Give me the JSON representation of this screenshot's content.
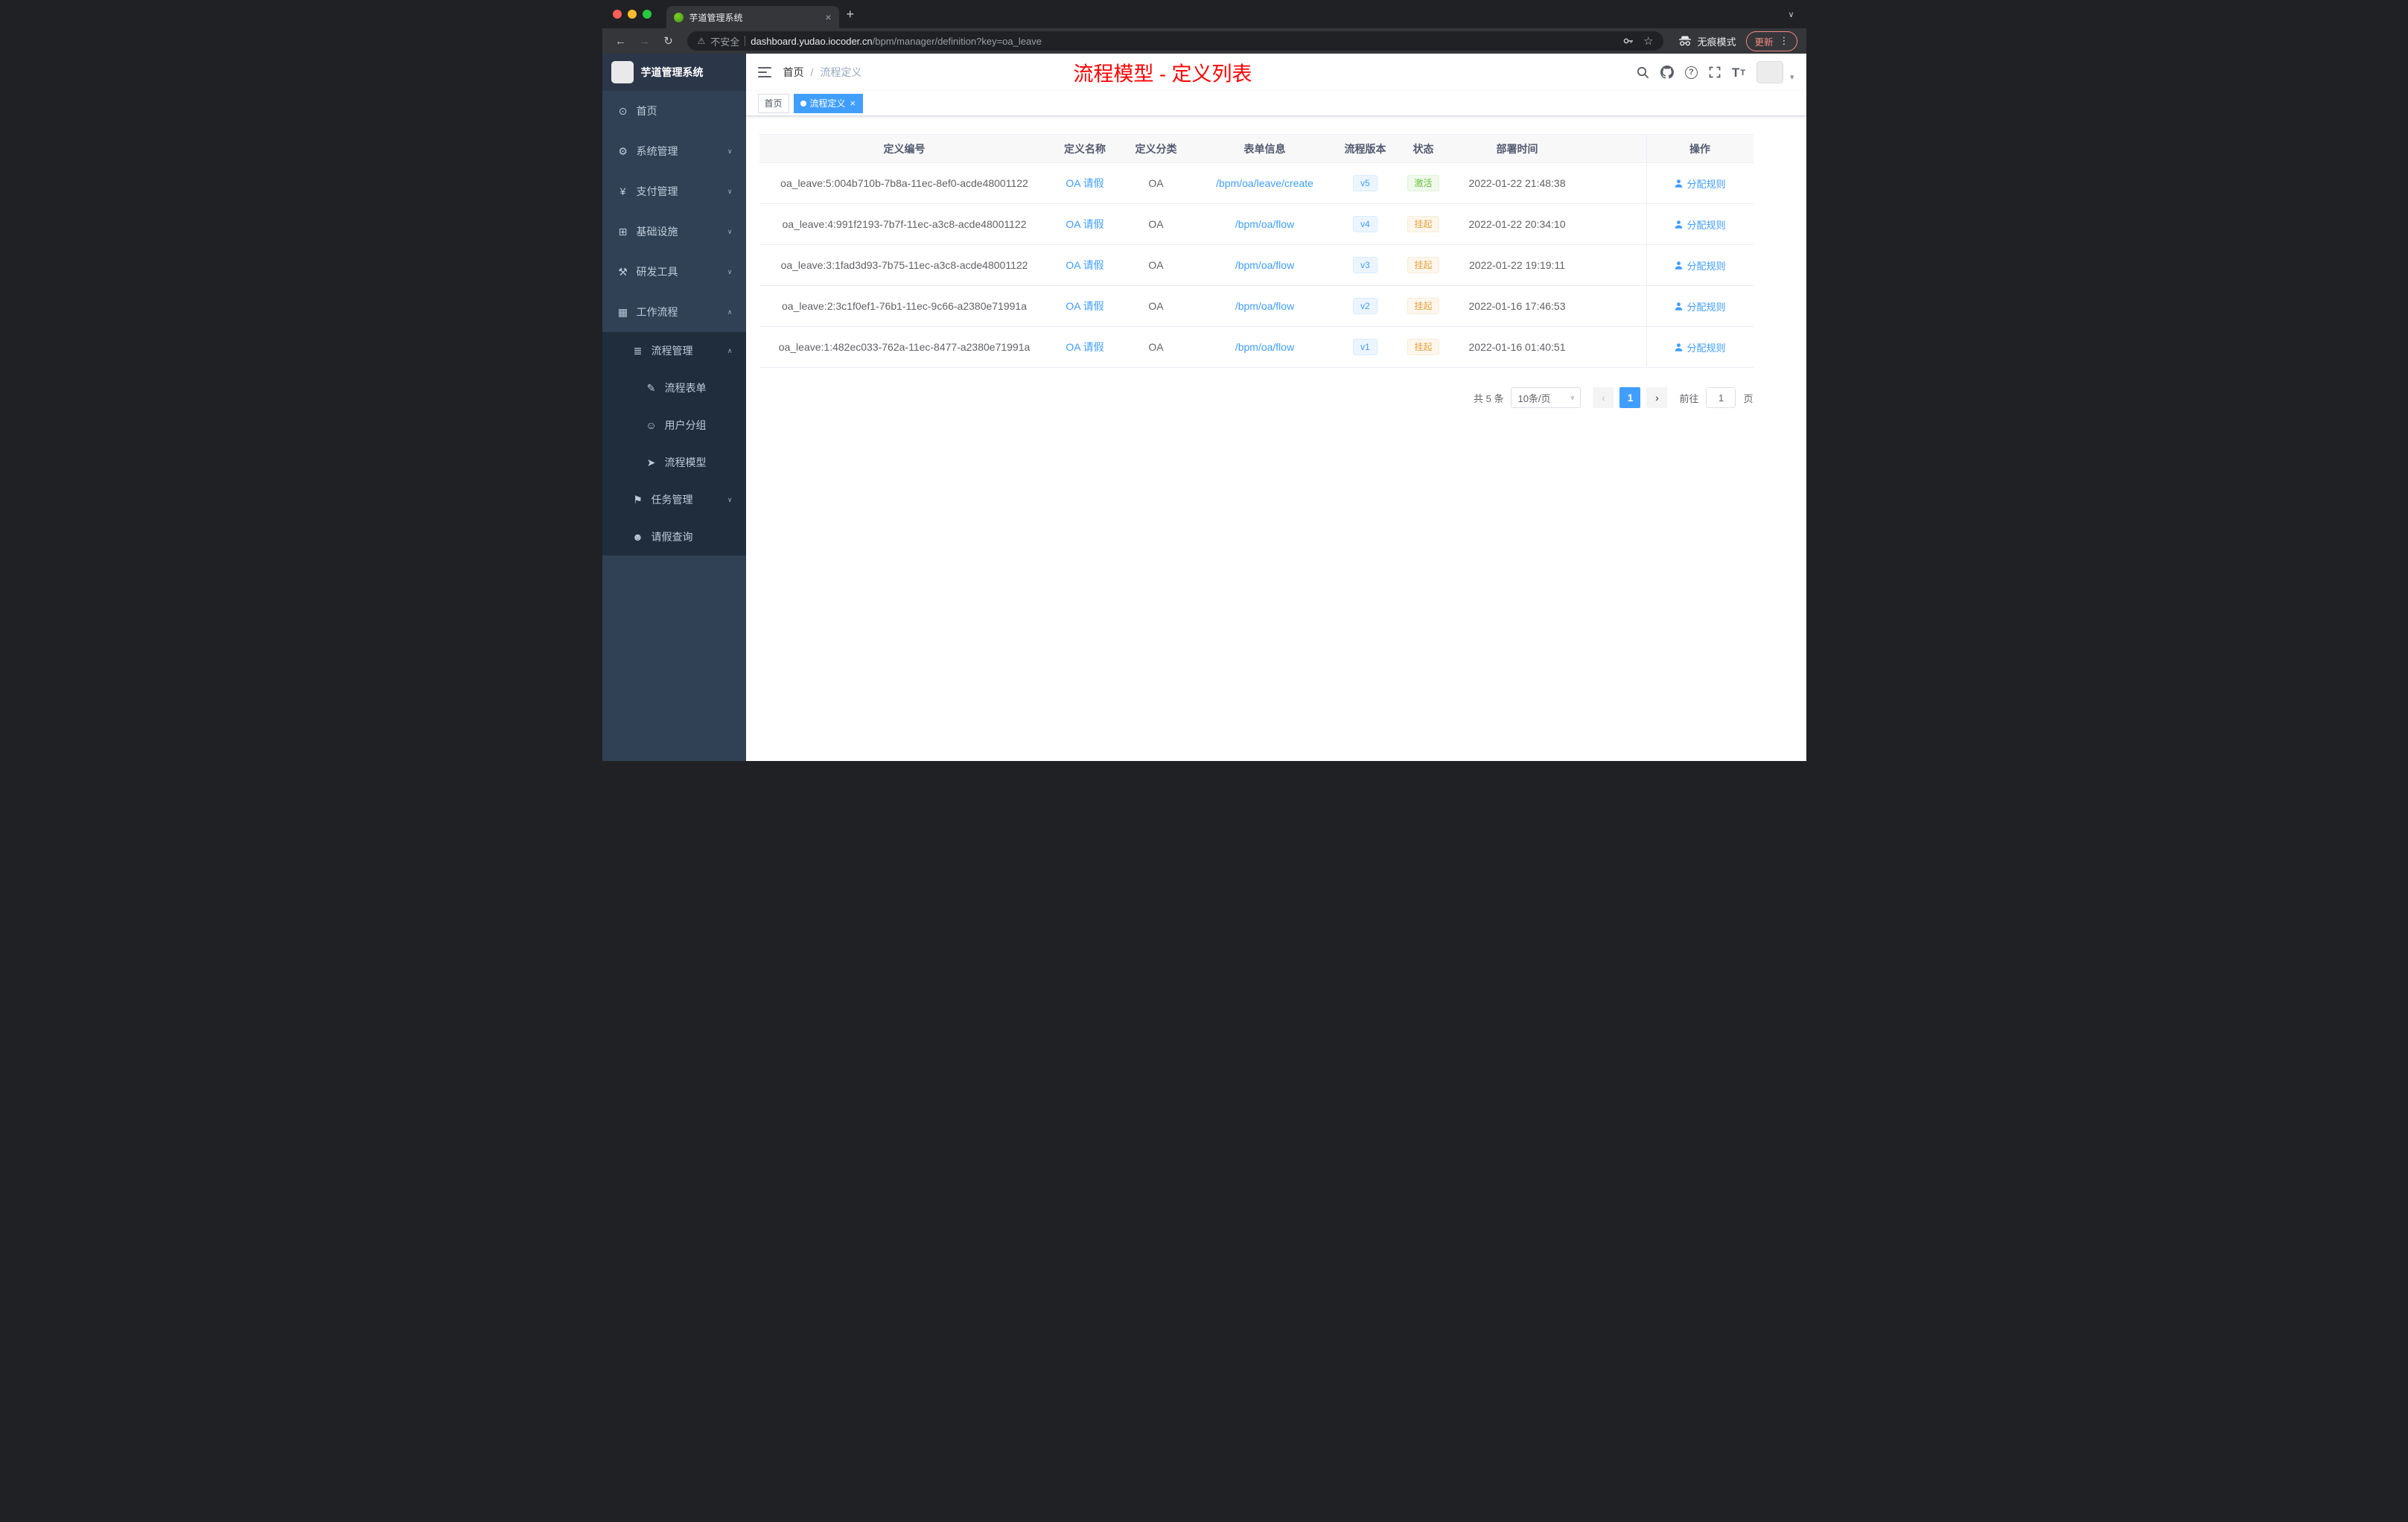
{
  "icons": {
    "close": "×",
    "plus": "+",
    "chevron_down": "∨",
    "chevron_up": "∧",
    "caret": "▾",
    "back": "←",
    "forward": "→",
    "reload": "↻",
    "warning": "⚠",
    "star": "☆",
    "dots": "⋮",
    "prev": "‹",
    "next": "›",
    "question": "?",
    "font_size": "T",
    "menu_glyphs": {
      "dashboard": "⊙",
      "gear": "⚙",
      "yen": "¥",
      "infra": "⊞",
      "tools": "⚒",
      "workflow": "▦",
      "list": "≣",
      "form": "✎",
      "users": "☺",
      "send": "➤",
      "tasks": "⚑",
      "person": "☻"
    }
  },
  "browser": {
    "tab": {
      "title": "芋道管理系统"
    },
    "address": {
      "security_label": "不安全",
      "url_host": "dashboard.yudao.iocoder.cn",
      "url_path": "/bpm/manager/definition?key=oa_leave",
      "incognito_label": "无痕模式",
      "update_label": "更新"
    }
  },
  "sidebar": {
    "logo_title": "芋道管理系统",
    "items": [
      {
        "key": "home",
        "label": "首页",
        "icon": "dashboard"
      },
      {
        "key": "system",
        "label": "系统管理",
        "icon": "gear",
        "arrow": "down"
      },
      {
        "key": "payment",
        "label": "支付管理",
        "icon": "yen",
        "arrow": "down"
      },
      {
        "key": "infrastructure",
        "label": "基础设施",
        "icon": "infra",
        "arrow": "down"
      },
      {
        "key": "devtools",
        "label": "研发工具",
        "icon": "tools",
        "arrow": "down"
      },
      {
        "key": "workflow",
        "label": "工作流程",
        "icon": "workflow",
        "arrow": "up"
      }
    ],
    "workflow_children": {
      "process_group": {
        "key": "process-management",
        "label": "流程管理",
        "icon": "list",
        "arrow": "up",
        "children": [
          {
            "key": "process-form",
            "label": "流程表单",
            "icon": "form"
          },
          {
            "key": "user-group",
            "label": "用户分组",
            "icon": "users"
          },
          {
            "key": "process-model",
            "label": "流程模型",
            "icon": "send"
          }
        ]
      },
      "task_group": {
        "key": "task-management",
        "label": "任务管理",
        "icon": "tasks",
        "arrow": "down"
      },
      "leave_item": {
        "key": "leave-query",
        "label": "请假查询",
        "icon": "person"
      }
    }
  },
  "navbar": {
    "breadcrumb": {
      "home": "首页",
      "sep": "/",
      "current": "流程定义"
    },
    "annotation": "流程模型 - 定义列表"
  },
  "tags": [
    {
      "key": "home",
      "label": "首页",
      "active": false,
      "closable": false
    },
    {
      "key": "process-definition",
      "label": "流程定义",
      "active": true,
      "closable": true
    }
  ],
  "table": {
    "columns": [
      "定义编号",
      "定义名称",
      "定义分类",
      "表单信息",
      "流程版本",
      "状态",
      "部署时间",
      "操作"
    ],
    "rows": [
      {
        "id": "oa_leave:5:004b710b-7b8a-11ec-8ef0-acde48001122",
        "name": "OA 请假",
        "category": "OA",
        "form": "/bpm/oa/leave/create",
        "version": "v5",
        "status": "激活",
        "status_type": "success",
        "time": "2022-01-22 21:48:38",
        "action": "分配规则"
      },
      {
        "id": "oa_leave:4:991f2193-7b7f-11ec-a3c8-acde48001122",
        "name": "OA 请假",
        "category": "OA",
        "form": "/bpm/oa/flow",
        "version": "v4",
        "status": "挂起",
        "status_type": "warning",
        "time": "2022-01-22 20:34:10",
        "action": "分配规则"
      },
      {
        "id": "oa_leave:3:1fad3d93-7b75-11ec-a3c8-acde48001122",
        "name": "OA 请假",
        "category": "OA",
        "form": "/bpm/oa/flow",
        "version": "v3",
        "status": "挂起",
        "status_type": "warning",
        "time": "2022-01-22 19:19:11",
        "action": "分配规则"
      },
      {
        "id": "oa_leave:2:3c1f0ef1-76b1-11ec-9c66-a2380e71991a",
        "name": "OA 请假",
        "category": "OA",
        "form": "/bpm/oa/flow",
        "version": "v2",
        "status": "挂起",
        "status_type": "warning",
        "time": "2022-01-16 17:46:53",
        "action": "分配规则"
      },
      {
        "id": "oa_leave:1:482ec033-762a-11ec-8477-a2380e71991a",
        "name": "OA 请假",
        "category": "OA",
        "form": "/bpm/oa/flow",
        "version": "v1",
        "status": "挂起",
        "status_type": "warning",
        "time": "2022-01-16 01:40:51",
        "action": "分配规则"
      }
    ]
  },
  "pagination": {
    "total_label": "共 5 条",
    "page_size_label": "10条/页",
    "page": "1",
    "goto_label": "前往",
    "goto_value": "1",
    "unit_label": "页"
  }
}
